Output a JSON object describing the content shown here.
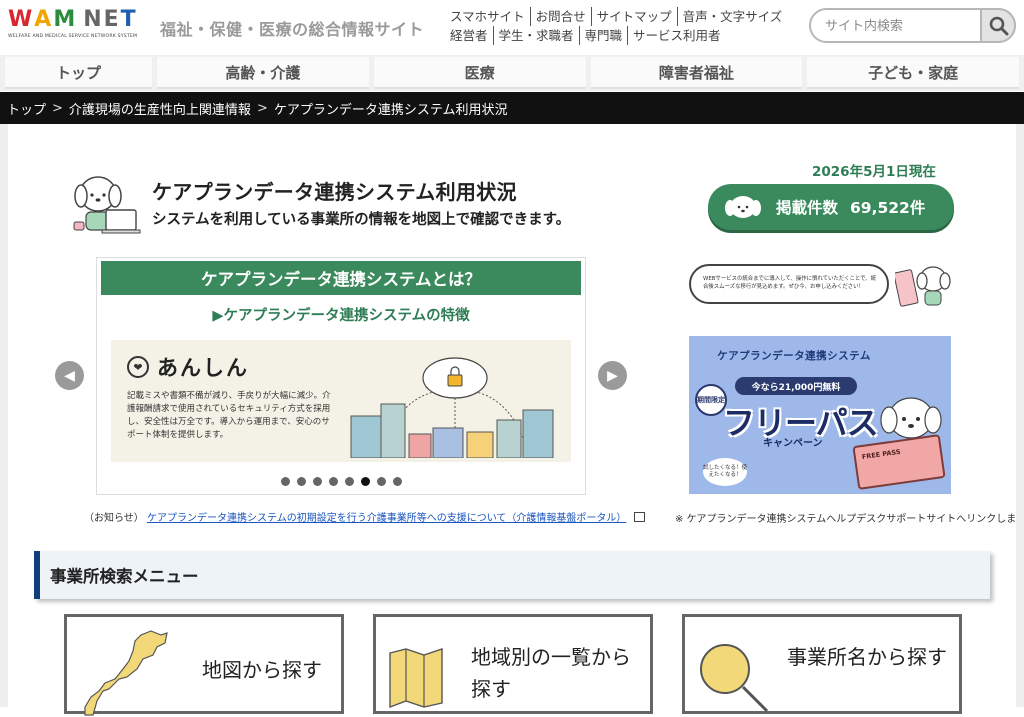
{
  "logo": {
    "main": "WAM NET",
    "sub": "WELFARE AND MEDICAL SERVICE NETWORK SYSTEM"
  },
  "header": {
    "tagline": "福祉・保健・医療の総合情報サイト",
    "links_row1": [
      "スマホサイト",
      "お問合せ",
      "サイトマップ",
      "音声・文字サイズ"
    ],
    "links_row2": [
      "経営者",
      "学生・求職者",
      "専門職",
      "サービス利用者"
    ]
  },
  "search": {
    "placeholder": "サイト内検索"
  },
  "nav": {
    "tabs": [
      "トップ",
      "高齢・介護",
      "医療",
      "障害者福祉",
      "子ども・家庭"
    ]
  },
  "breadcrumb": {
    "items": [
      "トップ",
      "介護現場の生産性向上関連情報",
      "ケアプランデータ連携システム利用状況"
    ],
    "separator": ">"
  },
  "page": {
    "title": "ケアプランデータ連携システム利用状況",
    "subtitle": "システムを利用している事業所の情報を地図上で確認できます。",
    "as_of": "2026年5月1日現在",
    "count_label": "掲載件数",
    "count_value": "69,522件"
  },
  "slider": {
    "header": "ケアプランデータ連携システムとは？",
    "feature_heading": "▶ケアプランデータ連携システムの特徴",
    "point_title": "あんしん",
    "point_text": "記載ミスや書類不備が減り、手戻りが大幅に減少。介護報酬請求で使用されているセキュリティ方式を採用し、安全性は万全です。導入から運用まで、安心のサポート体制を提供します。",
    "dot_count": 8,
    "active_dot": 6
  },
  "notice": {
    "prefix": "（お知らせ）",
    "link_text": "ケアプランデータ連携システムの初期設定を行う介護事業所等への支援について（介護情報基盤ポータル）"
  },
  "banner_a": {
    "text": "WEBサービスの統合までに導入して、操作に慣れていただくことで、統合後スムーズな移行が見込めます。ぜひ今、お申し込みください！"
  },
  "banner_b": {
    "title": "ケアプランデータ連携システム",
    "offer": "今なら21,000円無料",
    "limited": "期間限定",
    "main": "フリーパス",
    "campaign": "キャンペーン",
    "bubble": "試したくなる！使えたくなる！",
    "ticket": "FREE PASS"
  },
  "help_note": "※ ケアプランデータ連携システムヘルプデスクサポートサイトへリンクします",
  "section": {
    "title": "事業所検索メニュー",
    "cards": [
      "地図から探す",
      "地域別の一覧から探す",
      "事業所名から探す"
    ]
  },
  "colors": {
    "accent_green": "#3a8a5d",
    "nav_dark": "#111111",
    "section_border": "#0f3f7a",
    "link_blue": "#1a55c0"
  }
}
